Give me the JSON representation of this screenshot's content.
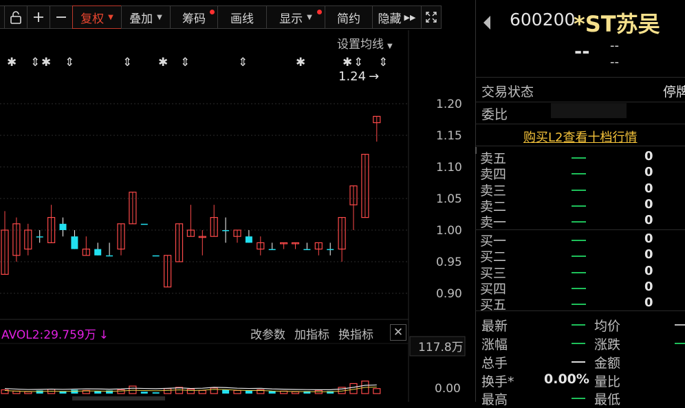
{
  "toolbar": {
    "buttons": [
      {
        "label": "复权",
        "active": true
      },
      {
        "label": "叠加"
      },
      {
        "label": "筹码"
      },
      {
        "label": "画线"
      },
      {
        "label": "显示"
      },
      {
        "label": "简约"
      },
      {
        "label": "隐藏"
      }
    ]
  },
  "chart": {
    "settings_label": "设置均线",
    "high_marker": "1.24",
    "vol_indicator": "AVOL2:29.759万",
    "vol_actions": [
      "改参数",
      "加指标",
      "换指标"
    ],
    "vol_max": "117.8万",
    "vol_min": "0.00"
  },
  "chart_data": {
    "type": "candlestick",
    "price_ticks": [
      1.2,
      1.15,
      1.1,
      1.05,
      1.0,
      0.95,
      0.9
    ],
    "ylim": [
      0.87,
      1.23
    ],
    "candles": [
      {
        "o": 1.0,
        "h": 1.03,
        "l": 0.93,
        "c": 0.93,
        "up": true
      },
      {
        "o": 0.96,
        "h": 1.02,
        "l": 0.95,
        "c": 1.01,
        "up": true
      },
      {
        "o": 0.97,
        "h": 1.01,
        "l": 0.96,
        "c": 1.0,
        "up": true
      },
      {
        "o": 0.99,
        "h": 1.0,
        "l": 0.98,
        "c": 0.99,
        "up": false
      },
      {
        "o": 0.98,
        "h": 1.04,
        "l": 0.98,
        "c": 1.02,
        "up": true
      },
      {
        "o": 1.01,
        "h": 1.02,
        "l": 0.99,
        "c": 1.0,
        "up": false
      },
      {
        "o": 0.99,
        "h": 1.0,
        "l": 0.97,
        "c": 0.97,
        "up": false
      },
      {
        "o": 0.96,
        "h": 0.99,
        "l": 0.96,
        "c": 0.97,
        "up": true
      },
      {
        "o": 0.97,
        "h": 0.98,
        "l": 0.96,
        "c": 0.96,
        "up": false
      },
      {
        "o": 0.96,
        "h": 0.98,
        "l": 0.96,
        "c": 0.96,
        "up": false
      },
      {
        "o": 0.97,
        "h": 1.01,
        "l": 0.96,
        "c": 1.01,
        "up": true
      },
      {
        "o": 1.01,
        "h": 1.06,
        "l": 1.01,
        "c": 1.06,
        "up": true
      },
      {
        "o": 1.01,
        "h": 1.01,
        "l": 1.01,
        "c": 1.01,
        "up": false
      },
      {
        "o": 0.96,
        "h": 0.96,
        "l": 0.96,
        "c": 0.96,
        "up": false
      },
      {
        "o": 0.91,
        "h": 0.96,
        "l": 0.91,
        "c": 0.96,
        "up": true
      },
      {
        "o": 0.95,
        "h": 1.01,
        "l": 0.95,
        "c": 1.01,
        "up": true
      },
      {
        "o": 0.99,
        "h": 1.04,
        "l": 0.99,
        "c": 1.0,
        "up": true
      },
      {
        "o": 0.99,
        "h": 1.0,
        "l": 0.96,
        "c": 0.99,
        "up": true
      },
      {
        "o": 0.99,
        "h": 1.04,
        "l": 0.99,
        "c": 1.02,
        "up": true
      },
      {
        "o": 1.0,
        "h": 1.02,
        "l": 0.98,
        "c": 1.0,
        "up": false
      },
      {
        "o": 0.99,
        "h": 1.0,
        "l": 0.98,
        "c": 1.0,
        "up": true
      },
      {
        "o": 0.99,
        "h": 1.0,
        "l": 0.98,
        "c": 0.98,
        "up": false
      },
      {
        "o": 0.97,
        "h": 0.99,
        "l": 0.96,
        "c": 0.98,
        "up": true
      },
      {
        "o": 0.97,
        "h": 0.98,
        "l": 0.97,
        "c": 0.97,
        "up": false
      },
      {
        "o": 0.98,
        "h": 0.98,
        "l": 0.97,
        "c": 0.98,
        "up": true
      },
      {
        "o": 0.98,
        "h": 0.98,
        "l": 0.97,
        "c": 0.98,
        "up": true
      },
      {
        "o": 0.97,
        "h": 0.98,
        "l": 0.97,
        "c": 0.97,
        "up": false
      },
      {
        "o": 0.97,
        "h": 0.98,
        "l": 0.96,
        "c": 0.98,
        "up": true
      },
      {
        "o": 0.97,
        "h": 0.98,
        "l": 0.96,
        "c": 0.97,
        "up": false
      },
      {
        "o": 0.97,
        "h": 1.02,
        "l": 0.95,
        "c": 1.02,
        "up": true
      },
      {
        "o": 1.04,
        "h": 1.07,
        "l": 1.0,
        "c": 1.07,
        "up": true
      },
      {
        "o": 1.02,
        "h": 1.12,
        "l": 1.02,
        "c": 1.12,
        "up": true
      },
      {
        "o": 1.17,
        "h": 1.18,
        "l": 1.14,
        "c": 1.18,
        "up": true
      }
    ],
    "volume": [
      0.06,
      0.04,
      0.03,
      0.05,
      0.07,
      0.04,
      0.06,
      0.05,
      0.04,
      0.05,
      0.06,
      0.12,
      0.03,
      0.02,
      0.08,
      0.1,
      0.07,
      0.05,
      0.09,
      0.06,
      0.05,
      0.05,
      0.06,
      0.04,
      0.04,
      0.03,
      0.04,
      0.05,
      0.04,
      0.1,
      0.16,
      0.2,
      0.08
    ],
    "vol_ylim": [
      0,
      1.178
    ]
  },
  "quote": {
    "code": "600200",
    "name": "*ST苏吴",
    "price": "--",
    "change": "--",
    "change_pct": "--",
    "status_label": "交易状态",
    "status_value": "停牌",
    "weibi_label": "委比",
    "l2_link": "购买L2查看十档行情",
    "asks": [
      {
        "label": "卖五",
        "price": "—",
        "vol": "0"
      },
      {
        "label": "卖四",
        "price": "—",
        "vol": "0"
      },
      {
        "label": "卖三",
        "price": "—",
        "vol": "0"
      },
      {
        "label": "卖二",
        "price": "—",
        "vol": "0"
      },
      {
        "label": "卖一",
        "price": "—",
        "vol": "0"
      }
    ],
    "bids": [
      {
        "label": "买一",
        "price": "—",
        "vol": "0"
      },
      {
        "label": "买二",
        "price": "—",
        "vol": "0"
      },
      {
        "label": "买三",
        "price": "—",
        "vol": "0"
      },
      {
        "label": "买四",
        "price": "—",
        "vol": "0"
      },
      {
        "label": "买五",
        "price": "—",
        "vol": "0"
      }
    ],
    "stats": {
      "latest_label": "最新",
      "latest": "—",
      "avg_label": "均价",
      "avg": "—",
      "pct_label": "涨幅",
      "pct": "—",
      "chg_label": "涨跌",
      "chg": "—",
      "hand_label": "总手",
      "hand": "—",
      "amount_label": "金额",
      "amount": "—",
      "turnover_label": "换手*",
      "turnover": "0.00%",
      "ratio_label": "量比",
      "ratio": "—",
      "high_label": "最高",
      "high": "—",
      "low_label": "最低",
      "low": "—"
    }
  },
  "colors": {
    "up": "#ff4a4a",
    "down": "#22e0f0",
    "accent": "#e8452f",
    "green": "#1ec15a"
  }
}
